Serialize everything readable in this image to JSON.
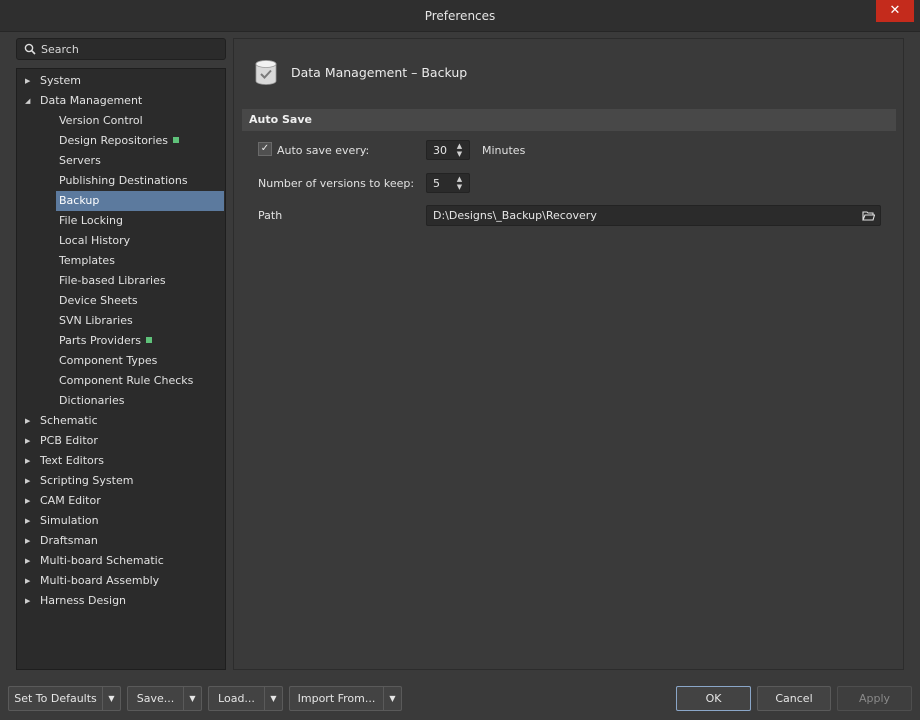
{
  "window": {
    "title": "Preferences",
    "close_glyph": "✕"
  },
  "search": {
    "placeholder": "Search",
    "value": ""
  },
  "tree": {
    "top_before": [
      {
        "label": "System",
        "expanded": false
      }
    ],
    "data_management": {
      "label": "Data Management",
      "expanded": true
    },
    "children": [
      {
        "label": "Version Control"
      },
      {
        "label": "Design Repositories",
        "badge": true
      },
      {
        "label": "Servers"
      },
      {
        "label": "Publishing Destinations"
      },
      {
        "label": "Backup",
        "selected": true
      },
      {
        "label": "File Locking"
      },
      {
        "label": "Local History"
      },
      {
        "label": "Templates"
      },
      {
        "label": "File-based Libraries"
      },
      {
        "label": "Device Sheets"
      },
      {
        "label": "SVN Libraries"
      },
      {
        "label": "Parts Providers",
        "badge": true
      },
      {
        "label": "Component Types"
      },
      {
        "label": "Component Rule Checks"
      },
      {
        "label": "Dictionaries"
      }
    ],
    "top_after": [
      {
        "label": "Schematic"
      },
      {
        "label": "PCB Editor"
      },
      {
        "label": "Text Editors"
      },
      {
        "label": "Scripting System"
      },
      {
        "label": "CAM Editor"
      },
      {
        "label": "Simulation"
      },
      {
        "label": "Draftsman"
      },
      {
        "label": "Multi-board Schematic"
      },
      {
        "label": "Multi-board Assembly"
      },
      {
        "label": "Harness Design"
      }
    ],
    "badge_color": "#5fc27a",
    "selected_color": "#5c7a9e"
  },
  "page": {
    "title": "Data Management – Backup",
    "icon": "database-check-icon",
    "section": "Auto Save",
    "autosave": {
      "label": "Auto save every:",
      "checked": true,
      "value": "30",
      "unit": "Minutes"
    },
    "versions": {
      "label": "Number of versions to keep:",
      "value": "5"
    },
    "path": {
      "label": "Path",
      "value": "D:\\Designs\\_Backup\\Recovery"
    }
  },
  "buttons": {
    "set_defaults": "Set To Defaults",
    "save": "Save...",
    "load": "Load...",
    "import_from": "Import From...",
    "ok": "OK",
    "cancel": "Cancel",
    "apply": "Apply"
  }
}
